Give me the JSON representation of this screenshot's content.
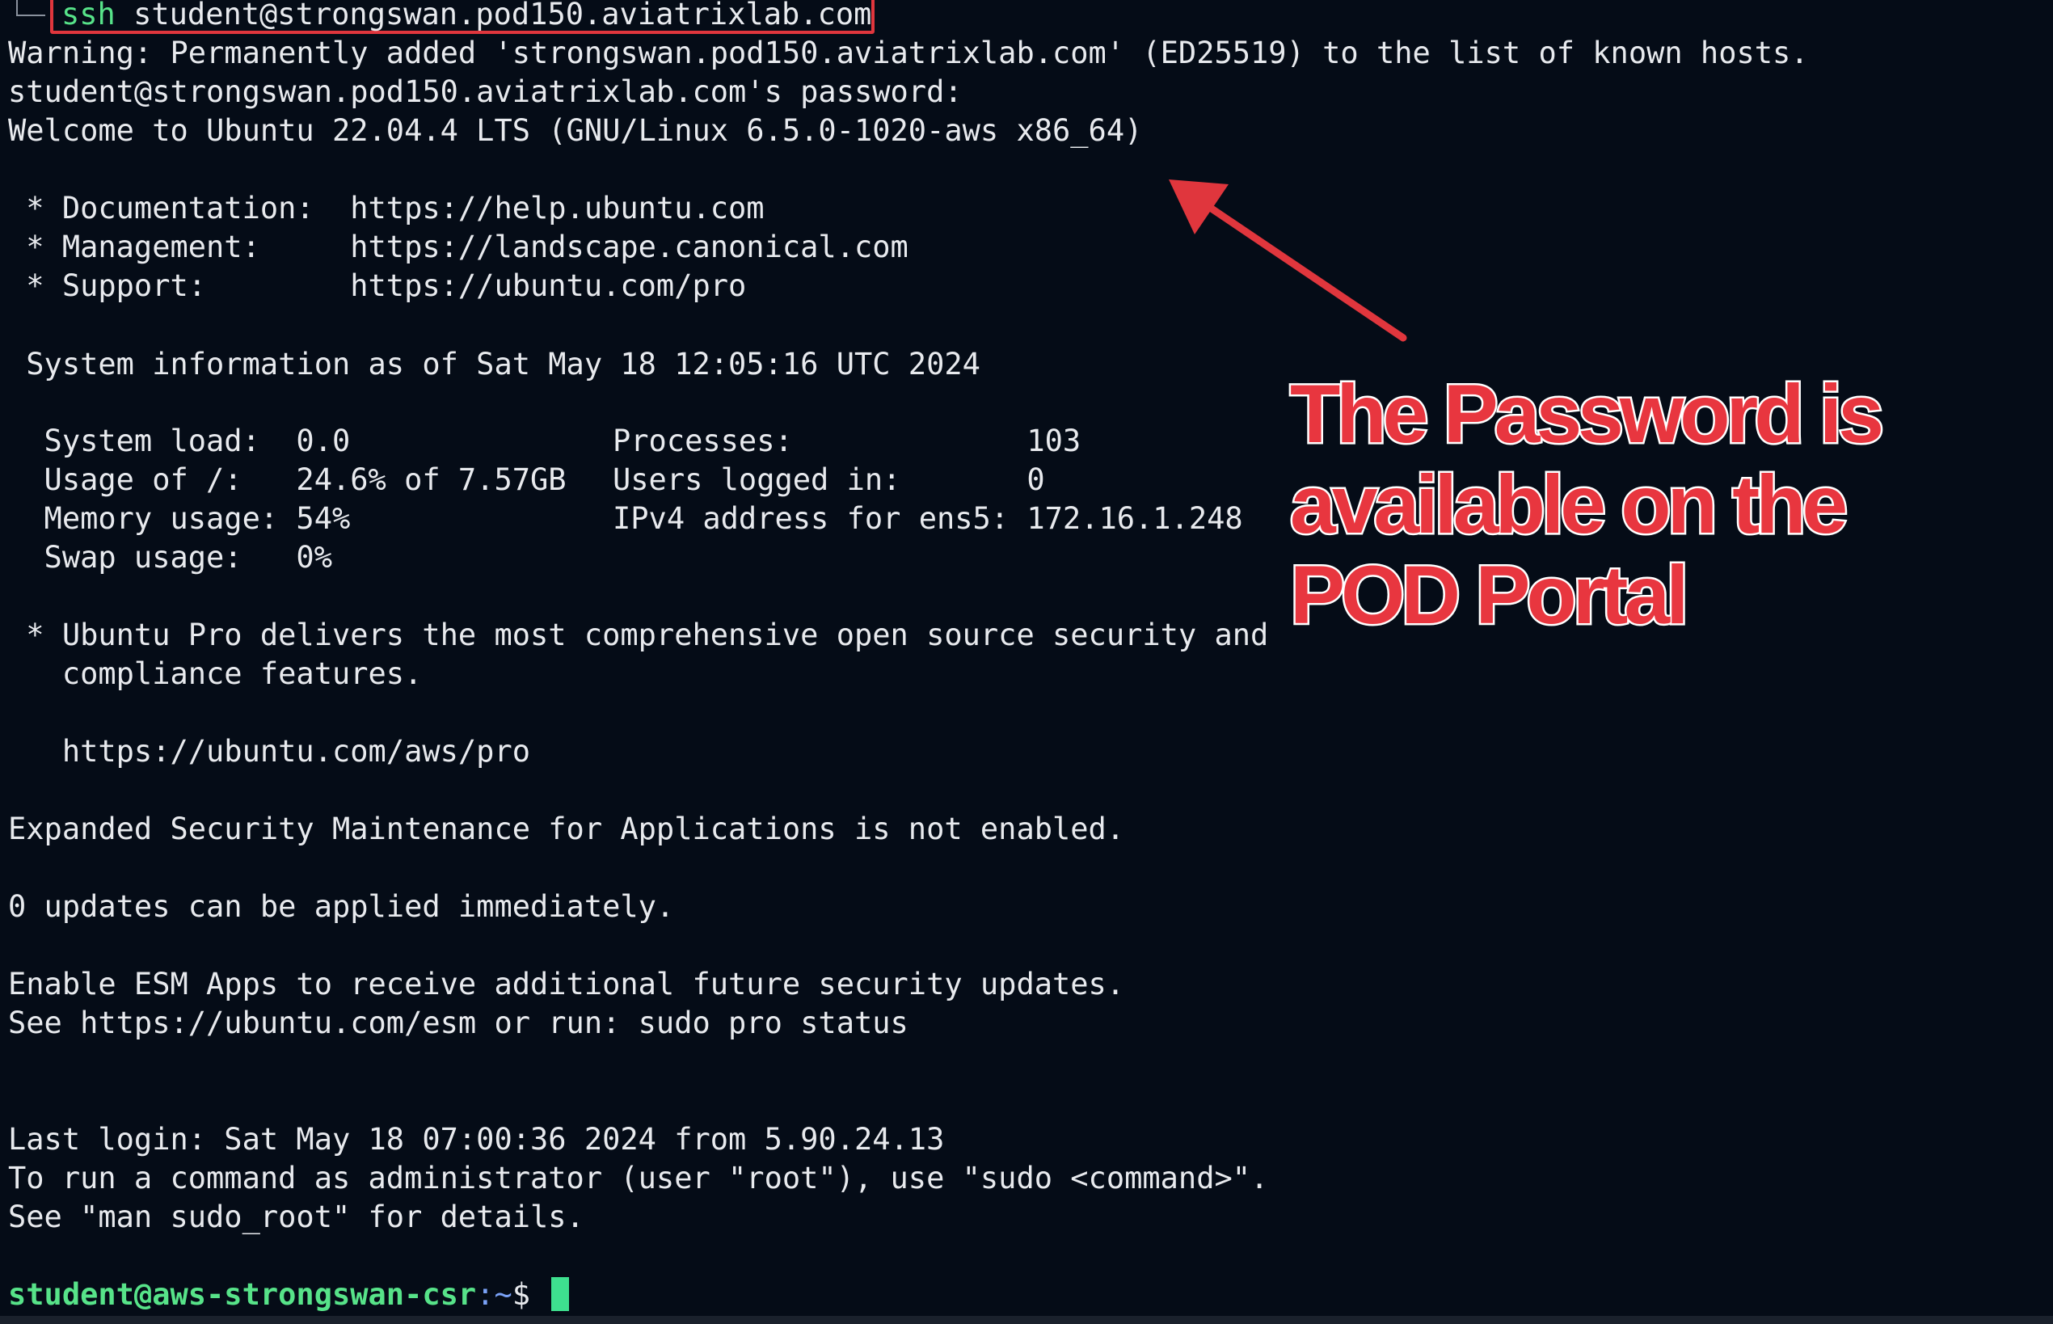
{
  "terminal": {
    "command": {
      "keyword": "ssh",
      "target": " student@strongswan.pod150.aviatrixlab.com"
    },
    "lines": [
      "Warning: Permanently added 'strongswan.pod150.aviatrixlab.com' (ED25519) to the list of known hosts.",
      "student@strongswan.pod150.aviatrixlab.com's password:",
      "Welcome to Ubuntu 22.04.4 LTS (GNU/Linux 6.5.0-1020-aws x86_64)",
      " * Documentation:  https://help.ubuntu.com",
      " * Management:     https://landscape.canonical.com",
      " * Support:        https://ubuntu.com/pro",
      " System information as of Sat May 18 12:05:16 UTC 2024"
    ],
    "sysinfo_left": [
      "  System load:  0.0",
      "  Usage of /:   24.6% of 7.57GB",
      "  Memory usage: 54%",
      "  Swap usage:   0%"
    ],
    "sysinfo_right": [
      "Processes:             103",
      "Users logged in:       0",
      "IPv4 address for ens5: 172.16.1.248"
    ],
    "pro_lines": [
      " * Ubuntu Pro delivers the most comprehensive open source security and",
      "   compliance features.",
      "   https://ubuntu.com/aws/pro"
    ],
    "esm_line": "Expanded Security Maintenance for Applications is not enabled.",
    "updates_line": "0 updates can be applied immediately.",
    "esm_apps_lines": [
      "Enable ESM Apps to receive additional future security updates.",
      "See https://ubuntu.com/esm or run: sudo pro status"
    ],
    "login_lines": [
      "Last login: Sat May 18 07:00:36 2024 from 5.90.24.13",
      "To run a command as administrator (user \"root\"), use \"sudo <command>\".",
      "See \"man sudo_root\" for details."
    ],
    "prompt": {
      "user_host": "student@aws-strongswan-csr",
      "path": ":~",
      "symbol": "$ "
    }
  },
  "annotation": {
    "lines": [
      "The Password is",
      "available on the",
      "POD Portal"
    ],
    "color": "#e8363f"
  },
  "colors": {
    "background": "#050c17",
    "text": "#e8eaee",
    "prompt_green": "#57e389",
    "cursor": "#3ee08f",
    "highlight_red": "#e0363d"
  }
}
